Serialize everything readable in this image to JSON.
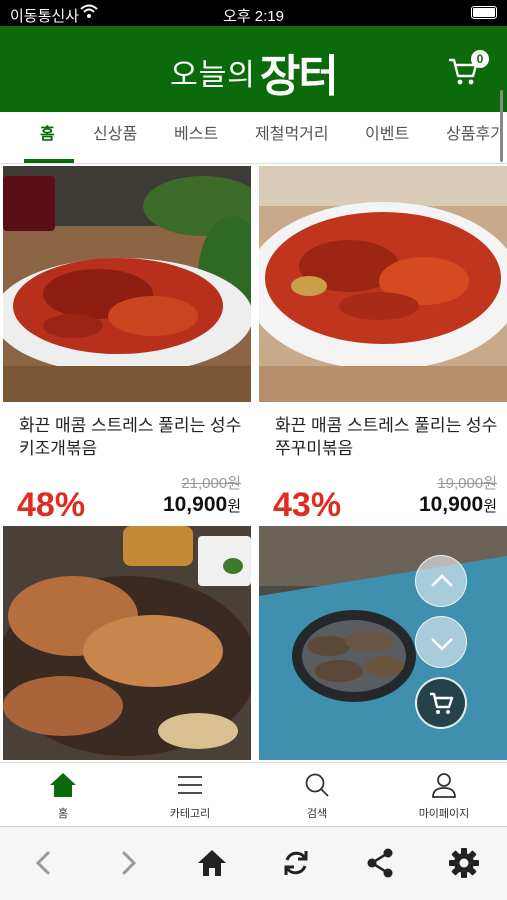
{
  "status_bar": {
    "carrier": "이동통신사",
    "time": "오후 2:19"
  },
  "header": {
    "logo_small": "오늘의",
    "logo_big": "장터",
    "cart_count": "0"
  },
  "tabs": [
    {
      "label": "홈"
    },
    {
      "label": "신상품"
    },
    {
      "label": "베스트"
    },
    {
      "label": "제철먹거리"
    },
    {
      "label": "이벤트"
    },
    {
      "label": "상품후기"
    }
  ],
  "products": [
    {
      "name": "화끈 매콤 스트레스 풀리는 성수키조개볶음",
      "original_price": "21,000원",
      "discount": "48%",
      "price": "10,900",
      "unit": "원"
    },
    {
      "name": "화끈 매콤 스트레스 풀리는 성수쭈꾸미볶음",
      "original_price": "19,000원",
      "discount": "43%",
      "price": "10,900",
      "unit": "원"
    }
  ],
  "bottom_nav": [
    {
      "label": "홈",
      "icon": "home-icon"
    },
    {
      "label": "카테고리",
      "icon": "menu-icon"
    },
    {
      "label": "검색",
      "icon": "search-icon"
    },
    {
      "label": "마이페이지",
      "icon": "user-icon"
    }
  ],
  "browser_bar": [
    "back-icon",
    "forward-icon",
    "home-icon",
    "refresh-icon",
    "share-icon",
    "settings-icon"
  ],
  "colors": {
    "brand_green": "#0b6b0b",
    "discount_red": "#e02b20"
  }
}
